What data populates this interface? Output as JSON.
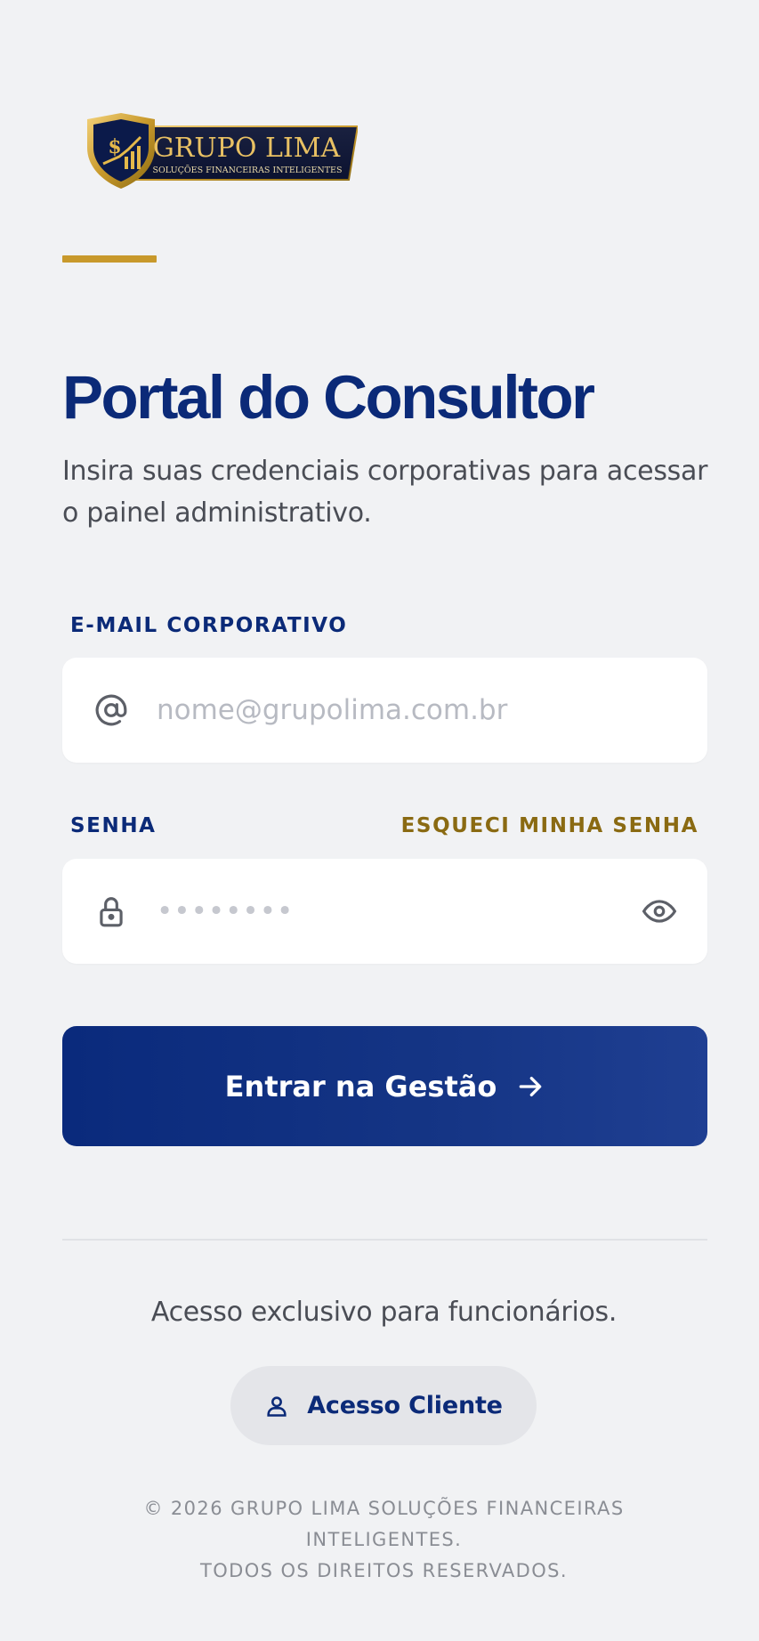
{
  "logo": {
    "brand_name": "GRUPO LIMA",
    "tagline": "SOLUÇÕES FINANCEIRAS INTELIGENTES",
    "icon": "shield-dollar-icon"
  },
  "header": {
    "title": "Portal do Consultor",
    "subtitle": "Insira suas credenciais corporativas para acessar o painel administrativo."
  },
  "form": {
    "email_label": "E-MAIL CORPORATIVO",
    "email_placeholder": "nome@grupolima.com.br",
    "email_icon": "at-icon",
    "password_label": "SENHA",
    "forgot_link": "ESQUECI MINHA SENHA",
    "password_placeholder": "••••••••",
    "password_icon": "lock-icon",
    "toggle_icon": "eye-icon",
    "submit_label": "Entrar na Gestão",
    "submit_icon": "arrow-right-icon"
  },
  "access": {
    "notice": "Acesso exclusivo para funcionários.",
    "client_button": "Acesso Cliente",
    "client_icon": "user-icon"
  },
  "footer": {
    "line1": "© 2026 GRUPO LIMA SOLUÇÕES FINANCEIRAS",
    "line2": "INTELIGENTES.",
    "line3": "TODOS OS DIREITOS RESERVADOS."
  },
  "colors": {
    "background": "#f1f2f4",
    "primary": "#0b2a78",
    "gold": "#c8992b",
    "gold_text": "#8a6a12"
  }
}
